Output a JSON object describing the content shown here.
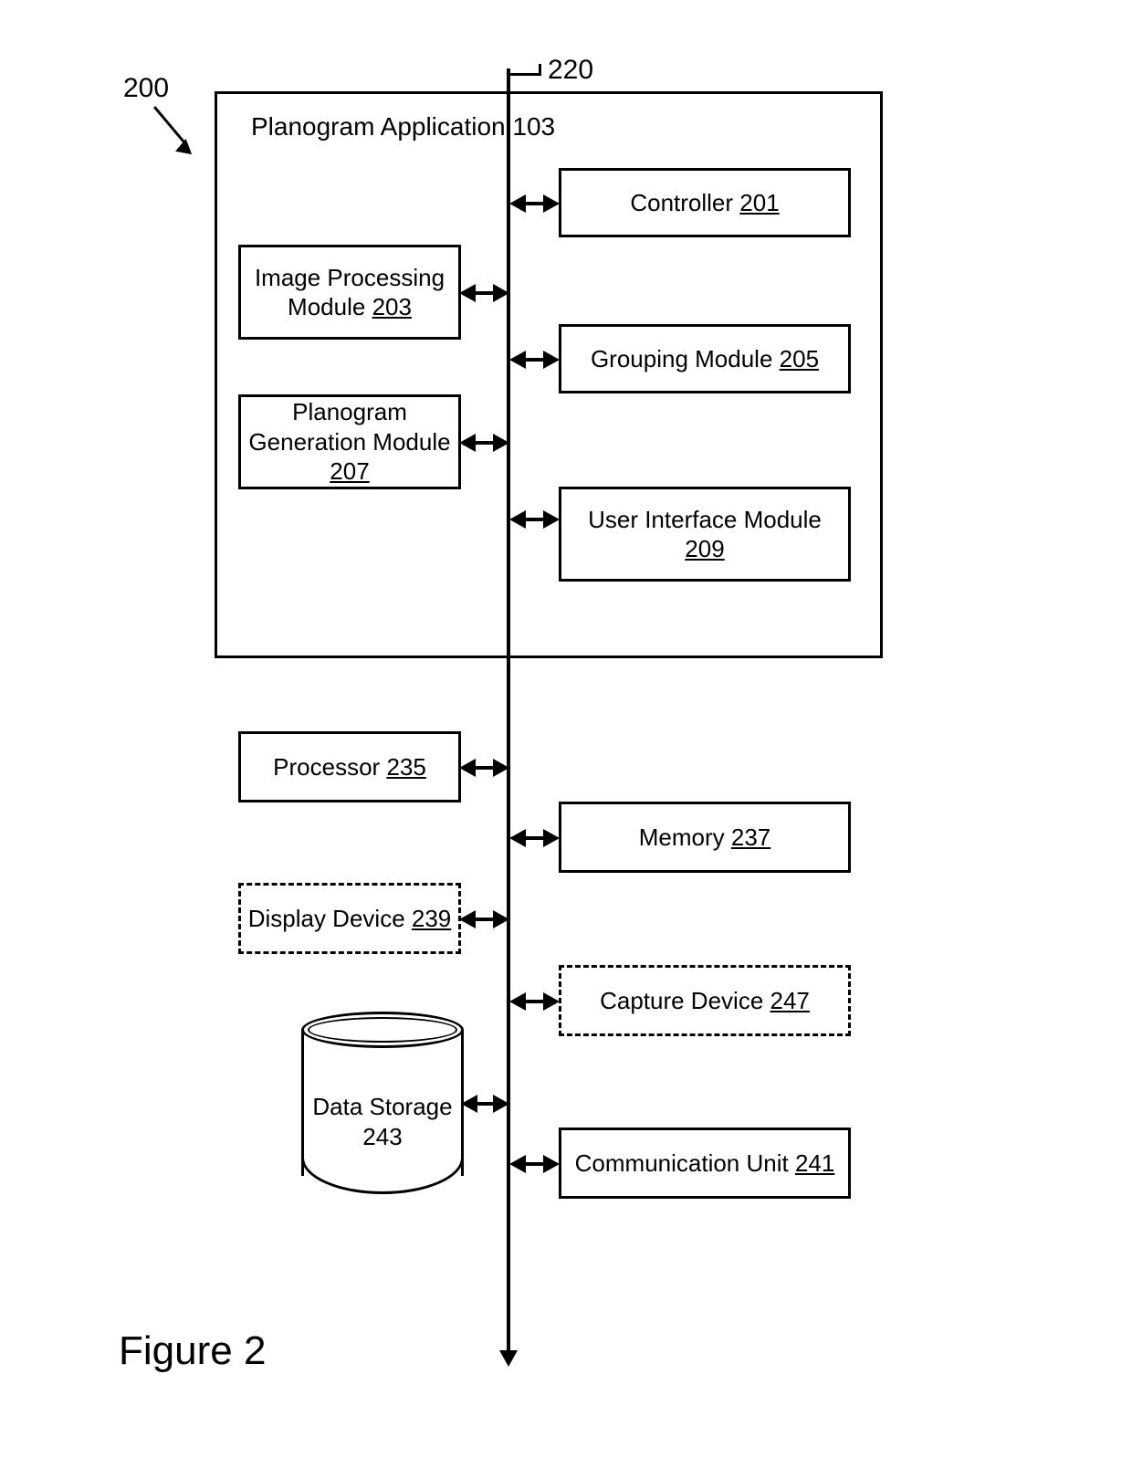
{
  "figure_caption": "Figure 2",
  "ref_200": "200",
  "ref_220": "220",
  "app": {
    "title": "Planogram Application",
    "num": "103"
  },
  "blocks": {
    "controller": {
      "label": "Controller",
      "num": "201"
    },
    "improc": {
      "label": "Image Processing Module",
      "num": "203"
    },
    "grouping": {
      "label": "Grouping Module",
      "num": "205"
    },
    "plangen": {
      "label": "Planogram Generation Module",
      "num": "207"
    },
    "uimod": {
      "label": "User Interface Module",
      "num": "209"
    },
    "processor": {
      "label": "Processor",
      "num": "235"
    },
    "memory": {
      "label": "Memory",
      "num": "237"
    },
    "display": {
      "label": "Display Device",
      "num": "239"
    },
    "capture": {
      "label": "Capture Device",
      "num": "247"
    },
    "storage": {
      "label": "Data Storage",
      "num": "243"
    },
    "comm": {
      "label": "Communication Unit",
      "num": "241"
    }
  }
}
